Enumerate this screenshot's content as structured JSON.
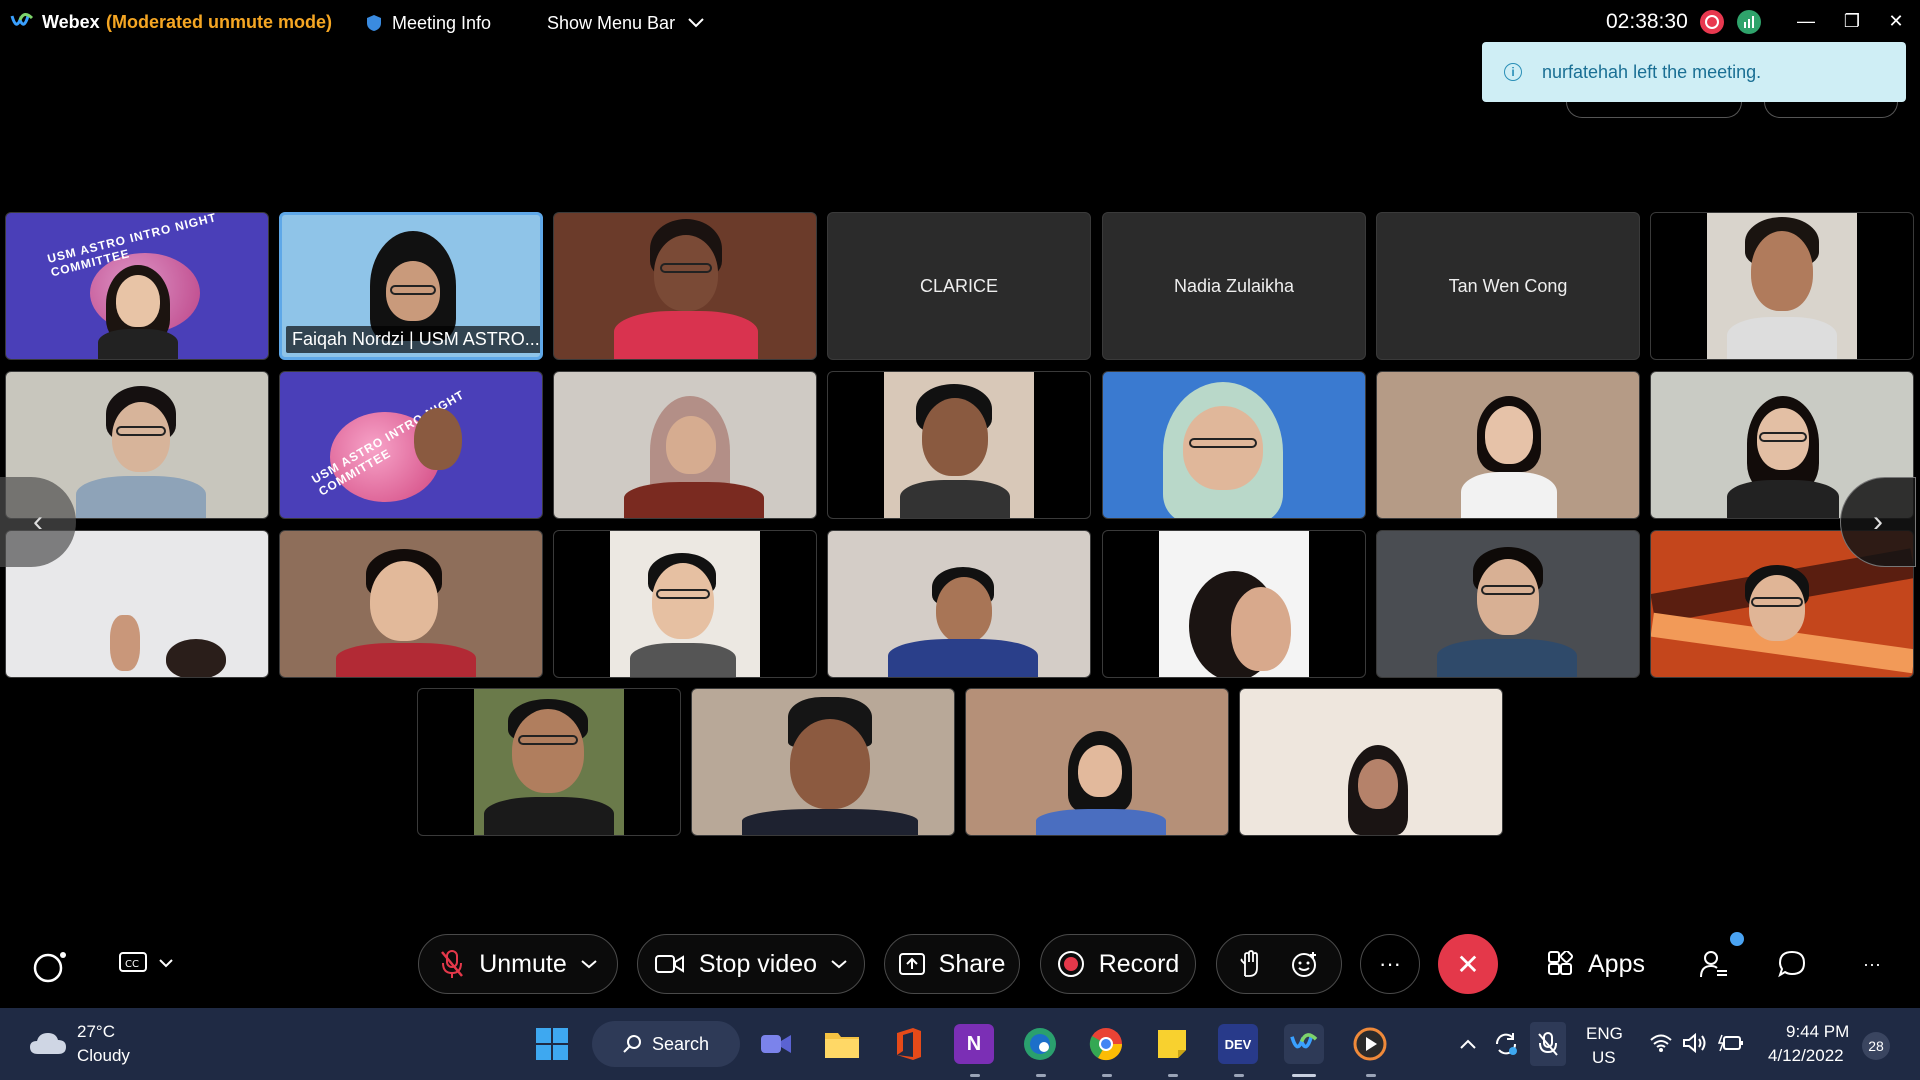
{
  "titlebar": {
    "app_name": "Webex",
    "mode": "(Moderated unmute mode)",
    "meeting_info_label": "Meeting Info",
    "show_menu_label": "Show Menu Bar",
    "timer": "02:38:30",
    "minimize": "—",
    "restore": "❐",
    "close": "✕"
  },
  "toast": {
    "icon": "i",
    "message": "nurfatehah left the meeting."
  },
  "participants": {
    "named_tiles": [
      "Faiqah Nordzi | USM ASTRO...",
      "CLARICE",
      "Nadia Zulaikha",
      "Tan Wen Cong"
    ]
  },
  "banner": {
    "text": "USM ASTRO INTRO NIGHT COMMITTEE"
  },
  "nav": {
    "prev": "‹",
    "next": "›"
  },
  "controls": {
    "unmute": "Unmute",
    "stop_video": "Stop video",
    "share": "Share",
    "record": "Record",
    "more": "···",
    "end": "✕",
    "apps": "Apps",
    "overflow": "···"
  },
  "taskbar": {
    "weather_temp": "27°C",
    "weather_desc": "Cloudy",
    "search_label": "Search",
    "lang_line1": "ENG",
    "lang_line2": "US",
    "time": "9:44 PM",
    "date": "4/12/2022",
    "notification_count": "28",
    "dev_label": "DEV"
  },
  "colors": {
    "accent_mode": "#f5a623",
    "toast_bg": "#cfeef5",
    "end_call": "#e4384a",
    "active_speaker_border": "#5fa8e8",
    "taskbar_bg": "#1f2a44"
  }
}
